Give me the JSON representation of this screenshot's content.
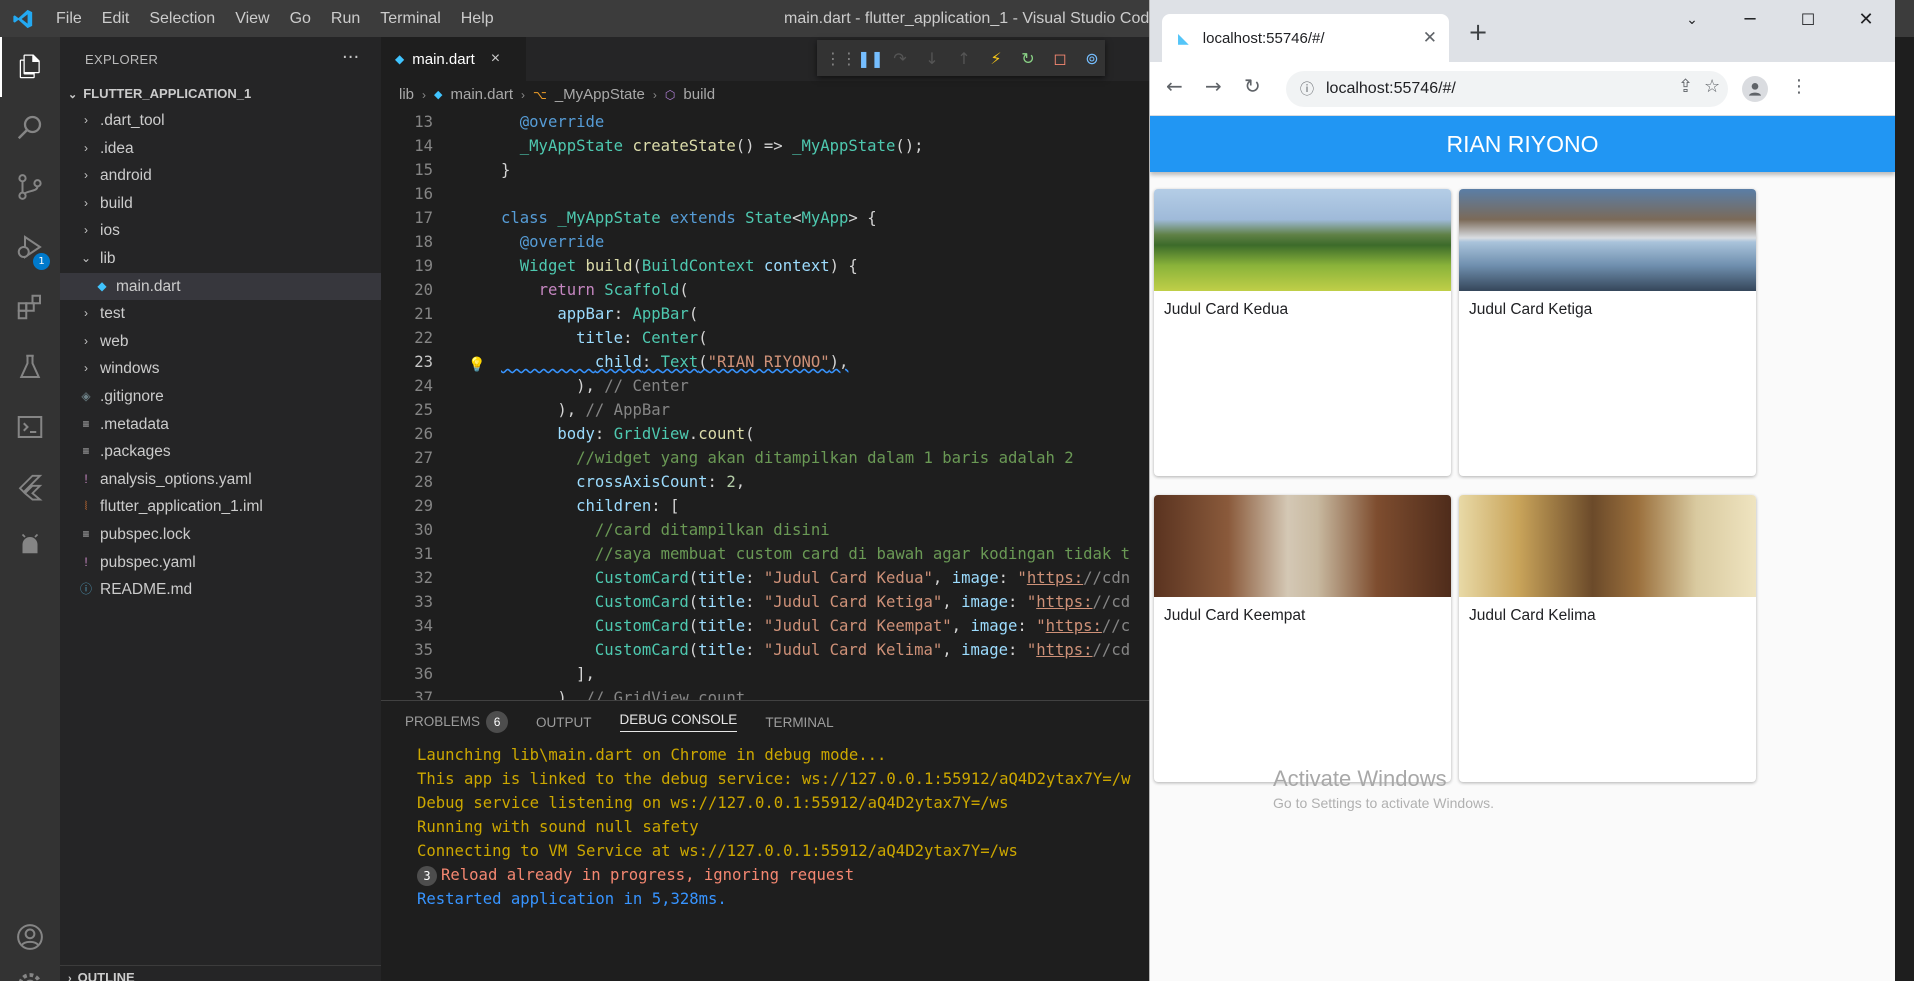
{
  "vscode": {
    "menu": [
      "File",
      "Edit",
      "Selection",
      "View",
      "Go",
      "Run",
      "Terminal",
      "Help"
    ],
    "window_title": "main.dart - flutter_application_1 - Visual Studio Code",
    "activity_badge": "1",
    "explorer": {
      "header": "EXPLORER",
      "root": "FLUTTER_APPLICATION_1",
      "items": [
        {
          "label": ".dart_tool",
          "type": "folder",
          "open": false
        },
        {
          "label": ".idea",
          "type": "folder",
          "open": false
        },
        {
          "label": "android",
          "type": "folder",
          "open": false
        },
        {
          "label": "build",
          "type": "folder",
          "open": false
        },
        {
          "label": "ios",
          "type": "folder",
          "open": false
        },
        {
          "label": "lib",
          "type": "folder",
          "open": true
        },
        {
          "label": "main.dart",
          "type": "dart",
          "selected": true
        },
        {
          "label": "test",
          "type": "folder",
          "open": false
        },
        {
          "label": "web",
          "type": "folder",
          "open": false
        },
        {
          "label": "windows",
          "type": "folder",
          "open": false
        },
        {
          "label": ".gitignore",
          "type": "git"
        },
        {
          "label": ".metadata",
          "type": "text"
        },
        {
          "label": ".packages",
          "type": "text"
        },
        {
          "label": "analysis_options.yaml",
          "type": "yaml"
        },
        {
          "label": "flutter_application_1.iml",
          "type": "xml"
        },
        {
          "label": "pubspec.lock",
          "type": "text"
        },
        {
          "label": "pubspec.yaml",
          "type": "yaml"
        },
        {
          "label": "README.md",
          "type": "info"
        }
      ],
      "outline": "OUTLINE"
    },
    "tab": {
      "label": "main.dart",
      "close": "×"
    },
    "breadcrumb": [
      "lib",
      "main.dart",
      "_MyAppState",
      "build"
    ],
    "code_lines": [
      {
        "n": "13",
        "text": "  @override"
      },
      {
        "n": "14",
        "text": "  _MyAppState createState() => _MyAppState();"
      },
      {
        "n": "15",
        "text": "}"
      },
      {
        "n": "16",
        "text": ""
      },
      {
        "n": "17",
        "text": "class _MyAppState extends State<MyApp> {"
      },
      {
        "n": "18",
        "text": "  @override"
      },
      {
        "n": "19",
        "text": "  Widget build(BuildContext context) {"
      },
      {
        "n": "20",
        "text": "    return Scaffold("
      },
      {
        "n": "21",
        "text": "      appBar: AppBar("
      },
      {
        "n": "22",
        "text": "        title: Center("
      },
      {
        "n": "23",
        "text": "          child: Text(\"RIAN RIYONO\"),"
      },
      {
        "n": "24",
        "text": "        ), // Center"
      },
      {
        "n": "25",
        "text": "      ), // AppBar"
      },
      {
        "n": "26",
        "text": "      body: GridView.count("
      },
      {
        "n": "27",
        "text": "        //widget yang akan ditampilkan dalam 1 baris adalah 2"
      },
      {
        "n": "28",
        "text": "        crossAxisCount: 2,"
      },
      {
        "n": "29",
        "text": "        children: ["
      },
      {
        "n": "30",
        "text": "          //card ditampilkan disini"
      },
      {
        "n": "31",
        "text": "          //saya membuat custom card di bawah agar kodingan tidak t"
      },
      {
        "n": "32",
        "text": "          CustomCard(title: \"Judul Card Kedua\", image: \"https://cdn"
      },
      {
        "n": "33",
        "text": "          CustomCard(title: \"Judul Card Ketiga\", image: \"https://cd"
      },
      {
        "n": "34",
        "text": "          CustomCard(title: \"Judul Card Keempat\", image: \"https://c"
      },
      {
        "n": "35",
        "text": "          CustomCard(title: \"Judul Card Kelima\", image: \"https://cd"
      },
      {
        "n": "36",
        "text": "        ],"
      },
      {
        "n": "37",
        "text": "      ), // GridView.count"
      }
    ],
    "panel": {
      "tabs": [
        "PROBLEMS",
        "OUTPUT",
        "DEBUG CONSOLE",
        "TERMINAL"
      ],
      "problems_count": "6",
      "active_tab": "DEBUG CONSOLE",
      "console": [
        {
          "text": "Launching lib\\main.dart on Chrome in debug mode...",
          "kind": "yellow"
        },
        {
          "text": "This app is linked to the debug service: ws://127.0.0.1:55912/aQ4D2ytax7Y=/w",
          "kind": "yellow"
        },
        {
          "text": "Debug service listening on ws://127.0.0.1:55912/aQ4D2ytax7Y=/ws",
          "kind": "yellow"
        },
        {
          "text": " Running with sound null safety",
          "kind": "yellow"
        },
        {
          "text": "Connecting to VM Service at ws://127.0.0.1:55912/aQ4D2ytax7Y=/ws",
          "kind": "yellow"
        },
        {
          "text": "Reload already in progress, ignoring request",
          "kind": "red",
          "repeat": "3"
        },
        {
          "text": "Restarted application in 5,328ms.",
          "kind": "blue"
        }
      ]
    }
  },
  "chrome": {
    "tab_title": "localhost:55746/#/",
    "url": "localhost:55746/#/",
    "app": {
      "title": "RIAN RIYONO",
      "cards": [
        {
          "title": "Judul Card Kedua",
          "image": "meadow-mountains"
        },
        {
          "title": "Judul Card Ketiga",
          "image": "mountain-lake-reflection"
        },
        {
          "title": "Judul Card Keempat",
          "image": "canyon"
        },
        {
          "title": "Judul Card Kelima",
          "image": "cable-car-rock"
        }
      ]
    }
  },
  "watermark": {
    "line1": "Activate Windows",
    "line2": "Go to Settings to activate Windows."
  }
}
